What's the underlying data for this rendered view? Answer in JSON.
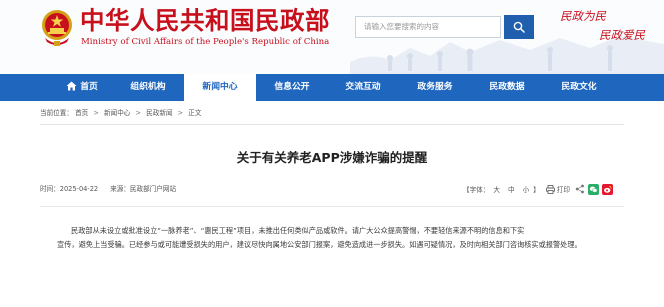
{
  "header": {
    "site_title": "中华人民共和国民政部",
    "site_subtitle": "Ministry of Civil Affairs of the People's Republic of China",
    "search_placeholder": "请输入您要搜索的内容",
    "slogan_line1": "民政为民",
    "slogan_line2": "民政爱民"
  },
  "nav": {
    "items": [
      {
        "label": "首页"
      },
      {
        "label": "组织机构"
      },
      {
        "label": "新闻中心"
      },
      {
        "label": "信息公开"
      },
      {
        "label": "交流互动"
      },
      {
        "label": "政务服务"
      },
      {
        "label": "民政数据"
      },
      {
        "label": "民政文化"
      }
    ],
    "active": "新闻中心"
  },
  "breadcrumb": {
    "prefix": "当前位置：",
    "items": [
      "首页",
      "新闻中心",
      "民政新闻",
      "正文"
    ],
    "separator": ">"
  },
  "article": {
    "title": "关于有关养老APP涉嫌诈骗的提醒",
    "time_label": "时间：",
    "time": "2025-04-22",
    "source_label": "来源：",
    "source": "民政部门户网站",
    "font_label": "【字体：",
    "font_large": "大",
    "font_medium": "中",
    "font_small": "小",
    "font_end": "】",
    "print_label": "打印",
    "paragraph_1": "民政部从未设立或批准设立“一脉养老”、“惠民工程”项目，未推出任何类似产品或软件。请广大公众提高警惕，不要轻信来源不明的信息和下实",
    "paragraph_2": "宣传，避免上当受骗。已经参与或可能遭受损失的用户，建议尽快向属地公安部门报案，避免造成进一步损失。如遇可疑情况，及时向相关部门咨询核实或报警处理。"
  },
  "colors": {
    "brand_red": "#c8101c",
    "nav_blue": "#1f66be",
    "wechat_green": "#2aae67",
    "weibo_red": "#e6162d"
  },
  "icons": [
    "emblem-icon",
    "search-icon",
    "home-icon",
    "print-icon",
    "share-icon",
    "wechat-icon",
    "weibo-icon"
  ]
}
